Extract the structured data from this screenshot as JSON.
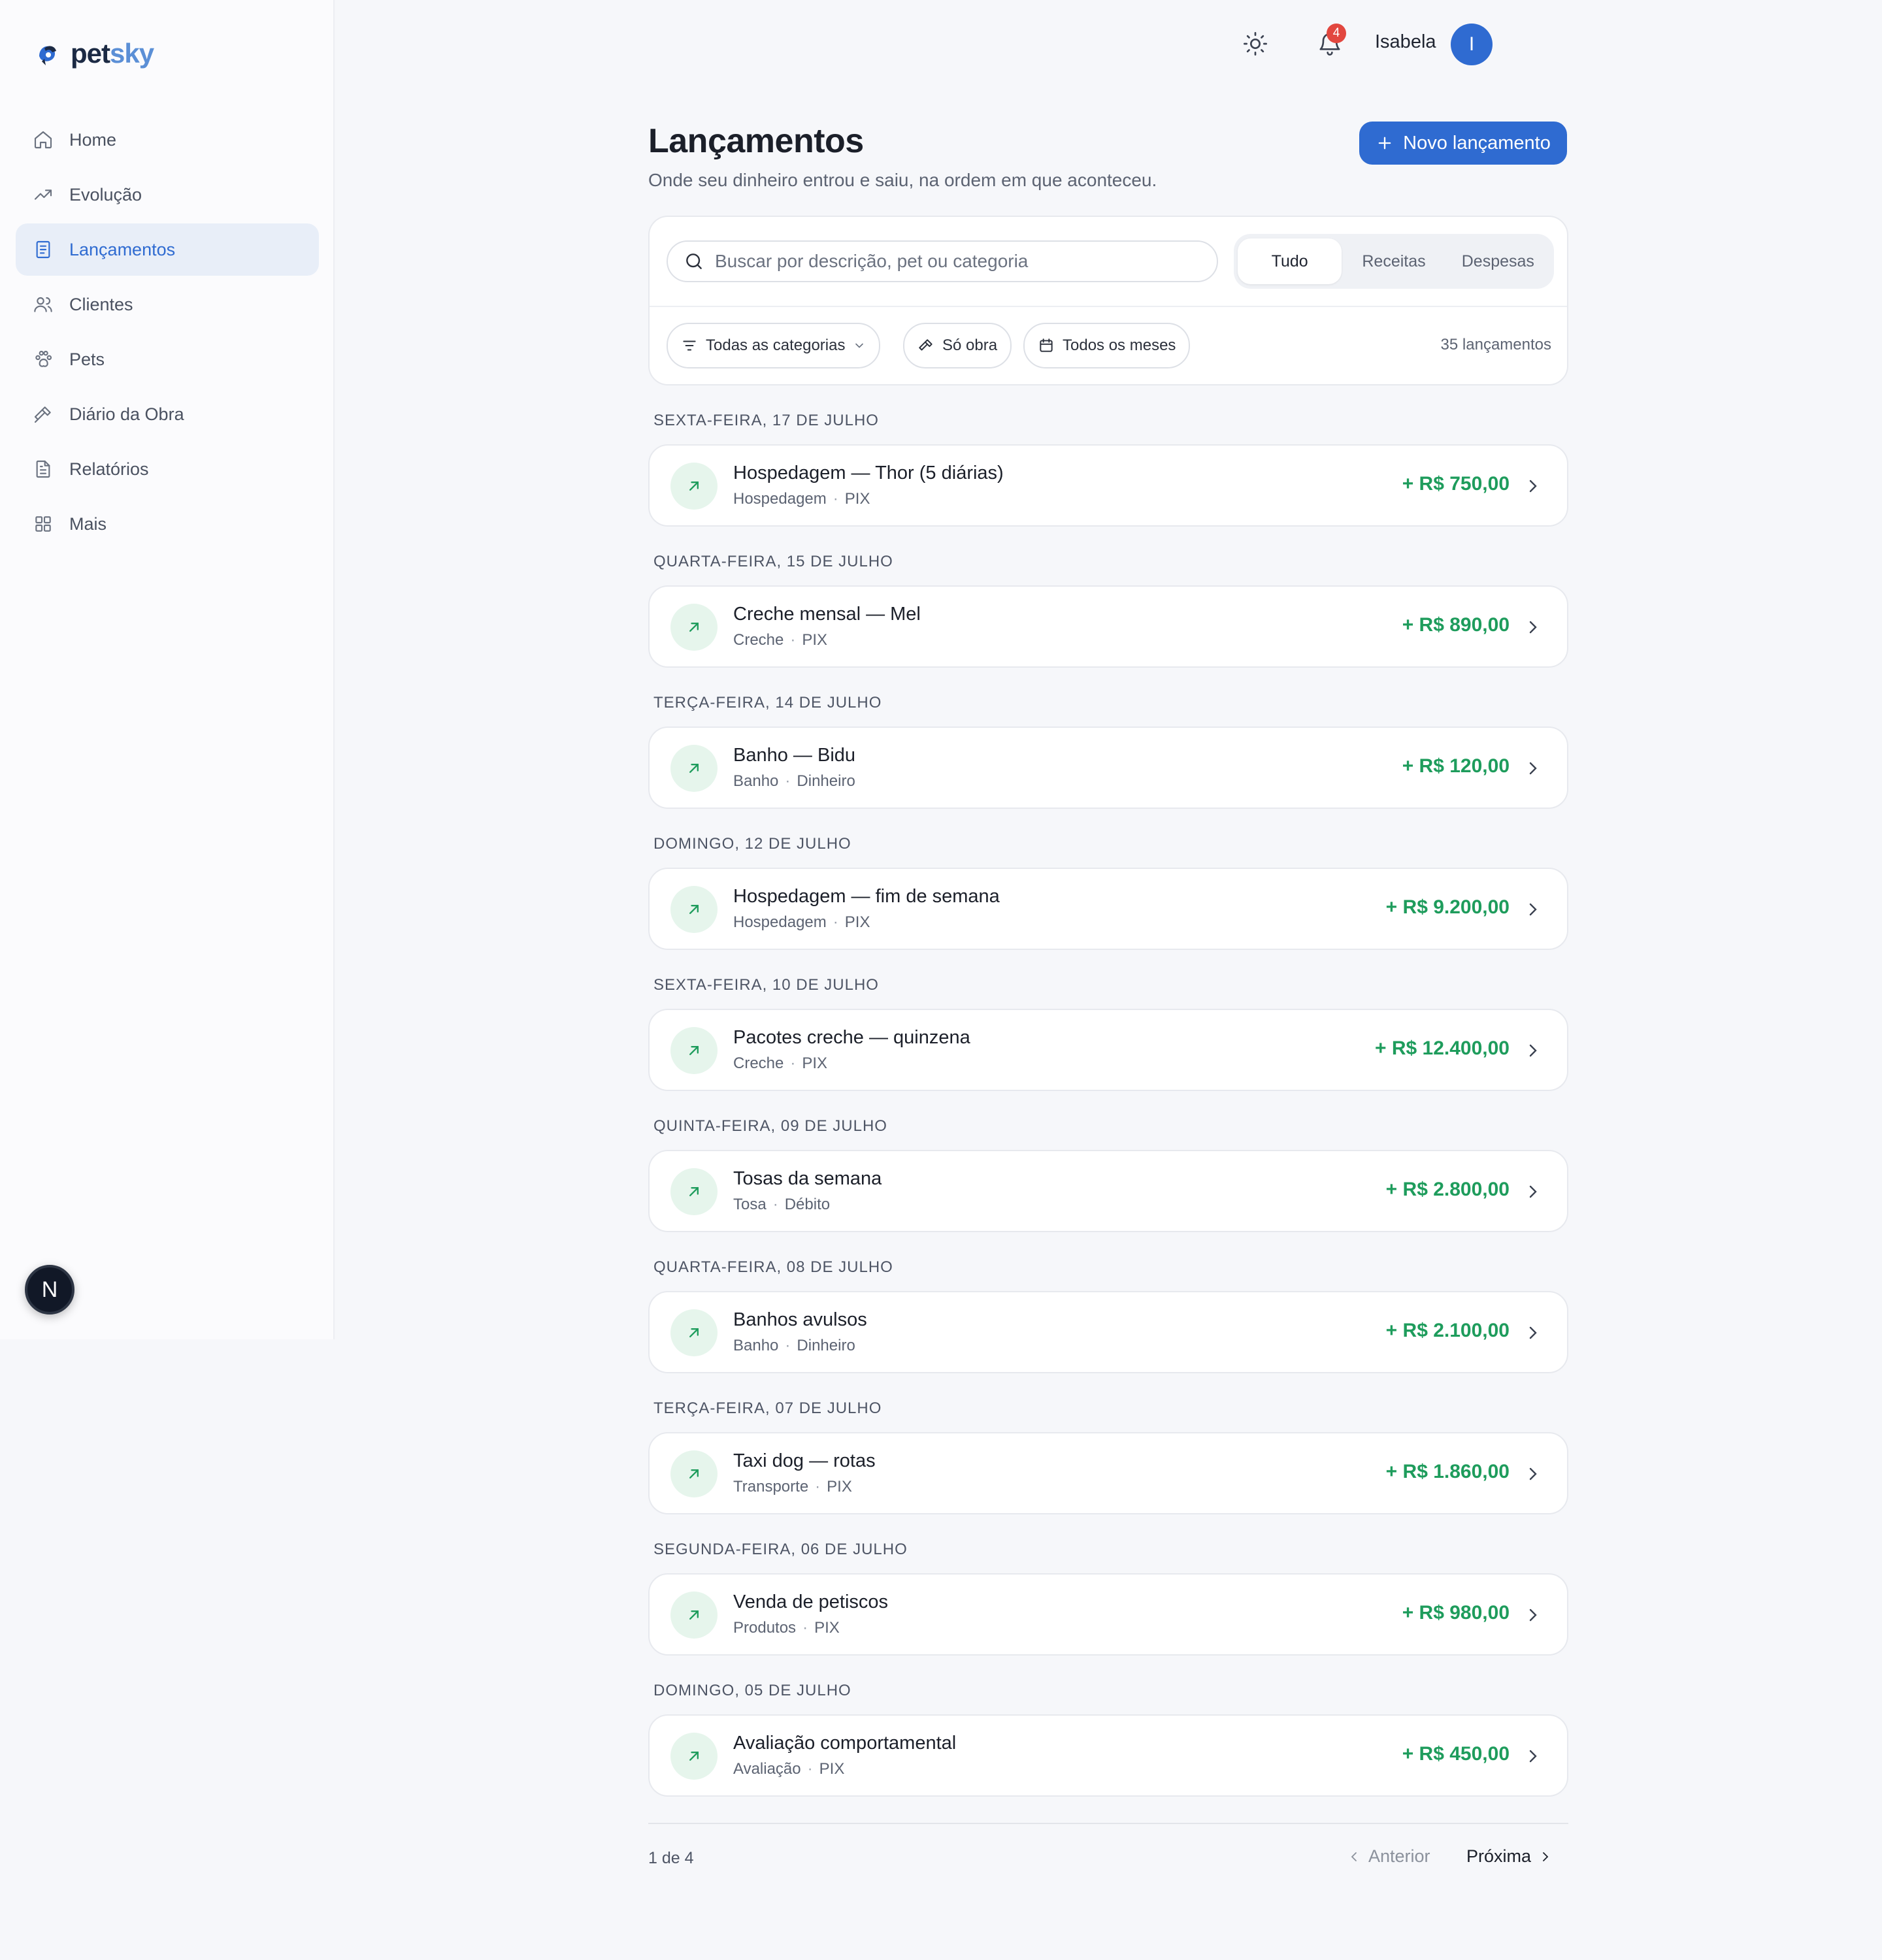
{
  "brand": {
    "name_part1": "pet",
    "name_part2": "sky"
  },
  "sidebar": {
    "items": [
      {
        "label": "Home",
        "icon": "home-icon"
      },
      {
        "label": "Evolução",
        "icon": "trending-up-icon"
      },
      {
        "label": "Lançamentos",
        "icon": "receipt-icon",
        "active": true
      },
      {
        "label": "Clientes",
        "icon": "users-icon"
      },
      {
        "label": "Pets",
        "icon": "paw-icon"
      },
      {
        "label": "Diário da Obra",
        "icon": "hammer-icon"
      },
      {
        "label": "Relatórios",
        "icon": "file-text-icon"
      },
      {
        "label": "Mais",
        "icon": "grid-icon"
      }
    ],
    "floating_badge": "N"
  },
  "topbar": {
    "notifications_count": "4",
    "user_name": "Isabela",
    "avatar_initial": "I"
  },
  "header": {
    "title": "Lançamentos",
    "subtitle": "Onde seu dinheiro entrou e saiu, na ordem em que aconteceu.",
    "new_button": "Novo lançamento"
  },
  "filters": {
    "search_placeholder": "Buscar por descrição, pet ou categoria",
    "segments": [
      "Tudo",
      "Receitas",
      "Despesas"
    ],
    "active_segment": "Tudo",
    "category_chip": "Todas as categorias",
    "obra_chip": "Só obra",
    "months_chip": "Todos os meses",
    "count": "35 lançamentos"
  },
  "groups": [
    {
      "date": "SEXTA-FEIRA, 17 DE JULHO",
      "title": "Hospedagem — Thor (5 diárias)",
      "category": "Hospedagem",
      "method": "PIX",
      "amount": "+ R$ 750,00"
    },
    {
      "date": "QUARTA-FEIRA, 15 DE JULHO",
      "title": "Creche mensal — Mel",
      "category": "Creche",
      "method": "PIX",
      "amount": "+ R$ 890,00"
    },
    {
      "date": "TERÇA-FEIRA, 14 DE JULHO",
      "title": "Banho — Bidu",
      "category": "Banho",
      "method": "Dinheiro",
      "amount": "+ R$ 120,00"
    },
    {
      "date": "DOMINGO, 12 DE JULHO",
      "title": "Hospedagem — fim de semana",
      "category": "Hospedagem",
      "method": "PIX",
      "amount": "+ R$ 9.200,00"
    },
    {
      "date": "SEXTA-FEIRA, 10 DE JULHO",
      "title": "Pacotes creche — quinzena",
      "category": "Creche",
      "method": "PIX",
      "amount": "+ R$ 12.400,00"
    },
    {
      "date": "QUINTA-FEIRA, 09 DE JULHO",
      "title": "Tosas da semana",
      "category": "Tosa",
      "method": "Débito",
      "amount": "+ R$ 2.800,00"
    },
    {
      "date": "QUARTA-FEIRA, 08 DE JULHO",
      "title": "Banhos avulsos",
      "category": "Banho",
      "method": "Dinheiro",
      "amount": "+ R$ 2.100,00"
    },
    {
      "date": "TERÇA-FEIRA, 07 DE JULHO",
      "title": "Taxi dog — rotas",
      "category": "Transporte",
      "method": "PIX",
      "amount": "+ R$ 1.860,00"
    },
    {
      "date": "SEGUNDA-FEIRA, 06 DE JULHO",
      "title": "Venda de petiscos",
      "category": "Produtos",
      "method": "PIX",
      "amount": "+ R$ 980,00"
    },
    {
      "date": "DOMINGO, 05 DE JULHO",
      "title": "Avaliação comportamental",
      "category": "Avaliação",
      "method": "PIX",
      "amount": "+ R$ 450,00"
    }
  ],
  "pagination": {
    "page_text": "1 de 4",
    "prev": "Anterior",
    "next": "Próxima"
  },
  "colors": {
    "accent": "#2f6bd1",
    "income": "#1e9c5c",
    "badge": "#e2473f"
  }
}
